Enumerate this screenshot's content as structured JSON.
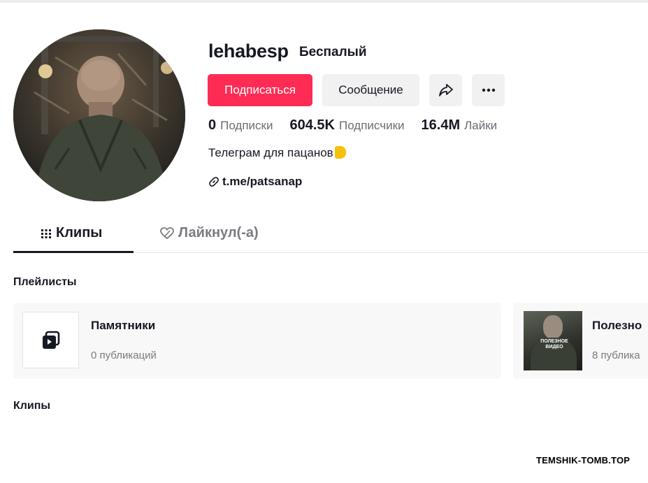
{
  "profile": {
    "username": "lehabesp",
    "nickname": "Беспалый",
    "follow_label": "Подписаться",
    "message_label": "Сообщение",
    "stats": {
      "following_count": "0",
      "following_label": "Подписки",
      "followers_count": "604.5K",
      "followers_label": "Подписчики",
      "likes_count": "16.4M",
      "likes_label": "Лайки"
    },
    "bio": "Телеграм для пацанов",
    "link": "t.me/patsanap"
  },
  "tabs": {
    "clips": "Клипы",
    "liked": "Лайкнул(-а)"
  },
  "playlists": {
    "title": "Плейлисты",
    "items": [
      {
        "name": "Памятники",
        "count": "0 публикаций"
      },
      {
        "name": "Полезно",
        "count": "8 публика"
      }
    ],
    "thumb_overlay": "ПОЛЕЗНОЕ ВИДЕО"
  },
  "clips_section": {
    "title": "Клипы"
  },
  "watermark": "TEMSHIK-TOMB.TOP",
  "colors": {
    "accent": "#fe2c55",
    "button_bg": "#f1f1f2",
    "text": "#161823",
    "muted": "#6b6b73"
  },
  "icons": [
    "share-icon",
    "more-icon",
    "link-icon",
    "grid-icon",
    "heart-icon",
    "playlist-icon"
  ]
}
